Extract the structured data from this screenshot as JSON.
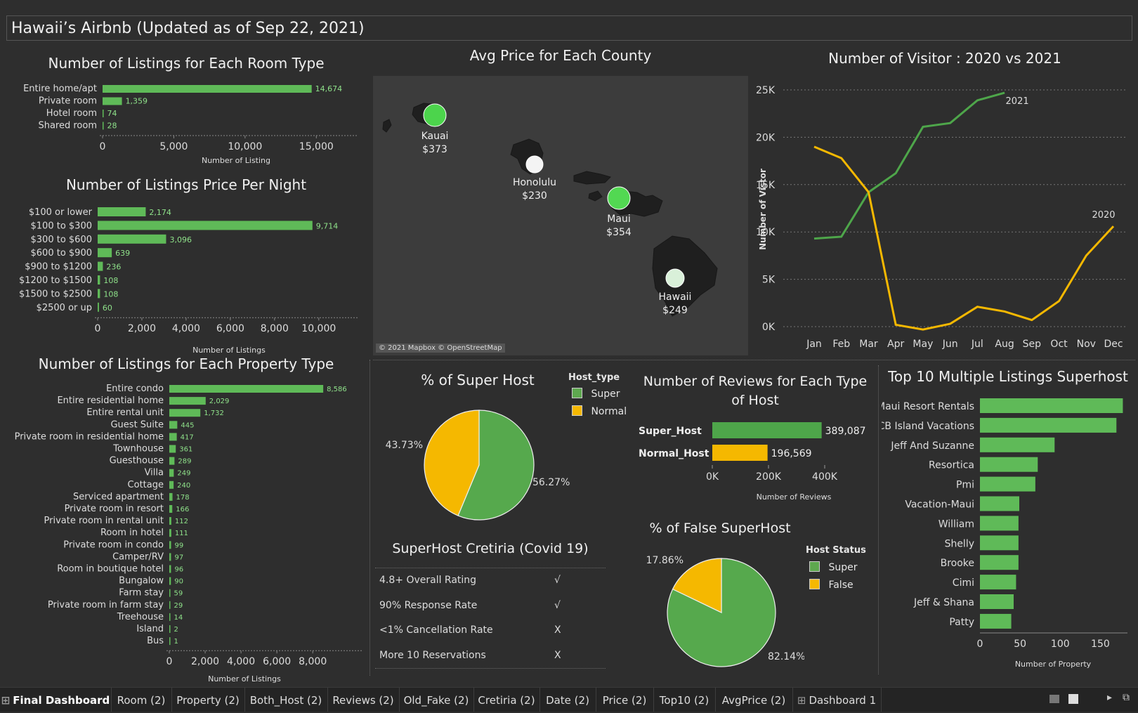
{
  "title": "Hawaii’s Airbnb (Updated as of Sep 22, 2021)",
  "colors": {
    "green": "#5fba58",
    "yellow": "#f5b800",
    "dark_green": "#4ea64a"
  },
  "room_type": {
    "title": "Number of Listings for Each Room Type",
    "xlabel": "Number of Listing",
    "ticks": [
      "0",
      "5,000",
      "10,000",
      "15,000"
    ],
    "chart_data": {
      "type": "bar",
      "categories": [
        "Entire home/apt",
        "Private room",
        "Hotel room",
        "Shared room"
      ],
      "values": [
        14674,
        1359,
        74,
        28
      ],
      "value_labels": [
        "14,674",
        "1,359",
        "74",
        "28"
      ],
      "xlim": [
        0,
        17500
      ]
    }
  },
  "price_night": {
    "title": "Number of Listings Price Per Night",
    "xlabel": "Number of Listings",
    "ticks": [
      "0",
      "2,000",
      "4,000",
      "6,000",
      "8,000",
      "10,000"
    ],
    "chart_data": {
      "type": "bar",
      "categories": [
        "$100 or lower",
        "$100 to $300",
        "$300 to $600",
        "$600 to $900",
        "$900 to $1200",
        "$1200 to $1500",
        "$1500 to $2500",
        "$2500 or up"
      ],
      "values": [
        2174,
        9714,
        3096,
        639,
        236,
        108,
        108,
        60
      ],
      "value_labels": [
        "2,174",
        "9,714",
        "3,096",
        "639",
        "236",
        "108",
        "108",
        "60"
      ],
      "xlim": [
        0,
        11500
      ]
    }
  },
  "property_type": {
    "title": "Number of Listings for Each  Property Type",
    "xlabel": "Number of Listings",
    "ticks": [
      "0",
      "2,000",
      "4,000",
      "6,000",
      "8,000"
    ],
    "chart_data": {
      "type": "bar",
      "categories": [
        "Entire condo",
        "Entire residential home",
        "Entire rental unit",
        "Guest Suite",
        "Private room in residential home",
        "Townhouse",
        "Guesthouse",
        "Villa",
        "Cottage",
        "Serviced apartment",
        "Private room in resort",
        "Private room in rental unit",
        "Room in hotel",
        "Private room in condo",
        "Camper/RV",
        "Room in boutique hotel",
        "Bungalow",
        "Farm stay",
        "Private room in farm stay",
        "Treehouse",
        "Island",
        "Bus"
      ],
      "values": [
        8586,
        2029,
        1732,
        445,
        417,
        361,
        289,
        249,
        240,
        178,
        166,
        112,
        111,
        99,
        97,
        96,
        90,
        59,
        29,
        14,
        2,
        1
      ],
      "value_labels": [
        "8,586",
        "2,029",
        "1,732",
        "445",
        "417",
        "361",
        "289",
        "249",
        "240",
        "178",
        "166",
        "112",
        "111",
        "99",
        "97",
        "96",
        "90",
        "59",
        "29",
        "14",
        "2",
        "1"
      ],
      "xlim": [
        0,
        10500
      ]
    }
  },
  "map": {
    "title": "Avg Price for Each County",
    "credit": "© 2021 Mapbox © OpenStreetMap",
    "counties": [
      {
        "name": "Kauai",
        "price": "$373",
        "color": "#4cd44c"
      },
      {
        "name": "Honolulu",
        "price": "$230",
        "color": "#f4f4f4"
      },
      {
        "name": "Maui",
        "price": "$354",
        "color": "#52d852"
      },
      {
        "name": "Hawaii",
        "price": "$249",
        "color": "#d9f0d9"
      }
    ]
  },
  "visitors": {
    "title": "Number of Visitor : 2020 vs 2021",
    "ylabel": "Number of Vistor",
    "yticks": [
      "0K",
      "5K",
      "10K",
      "15K",
      "20K",
      "25K"
    ],
    "chart_data": {
      "type": "line",
      "x": [
        "Jan",
        "Feb",
        "Mar",
        "Apr",
        "May",
        "Jun",
        "Jul",
        "Aug",
        "Sep",
        "Oct",
        "Nov",
        "Dec"
      ],
      "ylim": [
        0,
        25000
      ],
      "series": [
        {
          "name": "2021",
          "values": [
            9300,
            9500,
            14200,
            16200,
            21100,
            21500,
            23900,
            24700,
            null,
            null,
            null,
            null
          ]
        },
        {
          "name": "2020",
          "values": [
            19000,
            17800,
            14200,
            200,
            -300,
            300,
            2100,
            1600,
            700,
            2700,
            7500,
            10600
          ]
        }
      ]
    }
  },
  "super_host": {
    "title": "% of Super Host",
    "legend_title": "Host_type",
    "chart_data": {
      "type": "pie",
      "labels": [
        "Super",
        "Normal"
      ],
      "values": [
        56.27,
        43.73
      ],
      "value_labels": [
        "56.27%",
        "43.73%"
      ]
    }
  },
  "reviews": {
    "title": "Number of Reviews for Each Type of Host",
    "xlabel": "Number of Reviews",
    "ticks": [
      "0K",
      "200K",
      "400K"
    ],
    "chart_data": {
      "type": "bar",
      "categories": [
        "Super_Host",
        "Normal_Host"
      ],
      "values": [
        389087,
        196569
      ],
      "value_labels": [
        "389,087",
        "196,569"
      ],
      "xlim": [
        0,
        400000
      ]
    }
  },
  "criteria": {
    "title": "SuperHost Cretiria (Covid 19)",
    "rows": [
      {
        "label": "4.8+ Overall Rating",
        "mark": "√"
      },
      {
        "label": "90% Response Rate",
        "mark": "√"
      },
      {
        "label": "<1% Cancellation Rate",
        "mark": "X"
      },
      {
        "label": "More 10 Reservations",
        "mark": "X"
      }
    ]
  },
  "false_superhost": {
    "title": "% of False SuperHost",
    "legend_title": "Host Status",
    "chart_data": {
      "type": "pie",
      "labels": [
        "Super",
        "False"
      ],
      "values": [
        82.14,
        17.86
      ],
      "value_labels": [
        "82.14%",
        "17.86%"
      ]
    }
  },
  "top10": {
    "title": "Top 10 Multiple Listings Superhost",
    "xlabel": "Number of Property",
    "ticks": [
      "0",
      "50",
      "100",
      "150"
    ],
    "chart_data": {
      "type": "bar",
      "categories": [
        "Maui Resort Rentals",
        "CB Island Vacations",
        "Jeff And Suzanne",
        "Resortica",
        "Pmi",
        "Vacation-Maui",
        "William",
        "Shelly",
        "Brooke",
        "Cimi",
        "Jeff & Shana",
        "Patty"
      ],
      "values": [
        178,
        170,
        93,
        72,
        69,
        49,
        48,
        48,
        48,
        45,
        42,
        39
      ],
      "xlim": [
        0,
        175
      ]
    }
  },
  "tabs": [
    "Final Dashboard",
    "Room (2)",
    "Property (2)",
    "Both_Host (2)",
    "Reviews (2)",
    "Old_Fake (2)",
    "Cretiria (2)",
    "Date (2)",
    "Price (2)",
    "Top10 (2)",
    "AvgPrice (2)",
    "Dashboard 1"
  ]
}
